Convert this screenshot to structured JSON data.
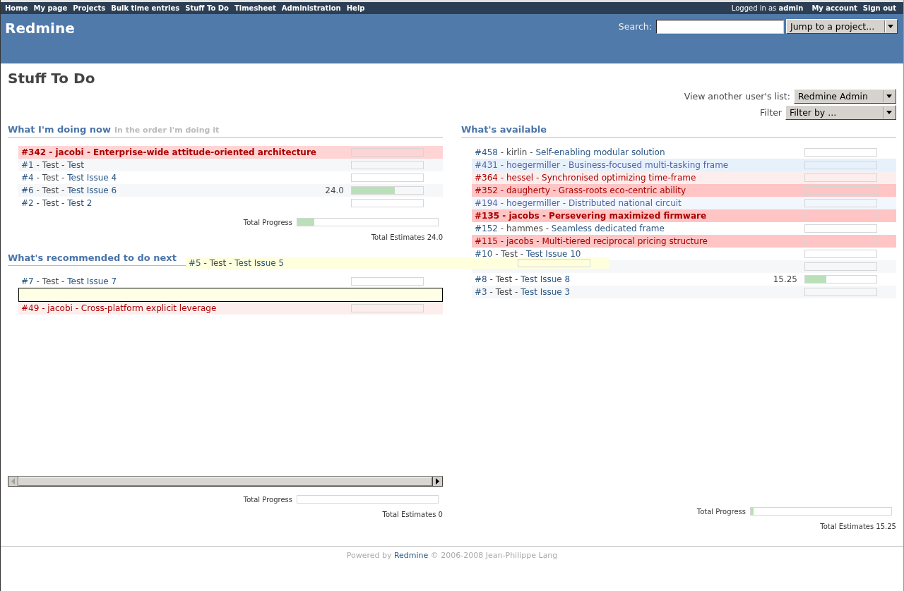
{
  "top_menu": {
    "items": [
      "Home",
      "My page",
      "Projects",
      "Bulk time entries",
      "Stuff To Do",
      "Timesheet",
      "Administration",
      "Help"
    ],
    "account": {
      "logged_in": "Logged in as **admin**",
      "links": [
        "My account",
        "Sign out"
      ]
    }
  },
  "header": {
    "title": "Redmine",
    "search_label": "Search:",
    "project_jump": "Jump to a project..."
  },
  "page_title": "Stuff To Do",
  "user_list": {
    "label": "View another user's list:",
    "value": "Redmine Admin"
  },
  "filter": {
    "label": "Filter",
    "value": "Filter by ..."
  },
  "doing_now": {
    "title": "What I'm doing now",
    "subtitle": "In the order I'm doing it",
    "items": [
      {
        "kind": "immediate",
        "number": "#342",
        "project": "- jacobi -",
        "subject": "Enterprise-wide attitude-oriented architecture",
        "level": 0
      },
      {
        "kind": "normal",
        "number": "#1",
        "project": "- Test -",
        "subject": "Test",
        "level": 0
      },
      {
        "kind": "normal",
        "number": "#4",
        "project": "- Test -",
        "subject": "Test Issue 4",
        "level": 0
      },
      {
        "kind": "normal",
        "number": "#6",
        "project": "- Test -",
        "subject": "Test Issue 6",
        "estimate": "24.0",
        "level": 0.6
      },
      {
        "kind": "normal",
        "number": "#2",
        "project": "- Test -",
        "subject": "Test 2",
        "level": 0
      }
    ],
    "total_progress": {
      "label": "Total Progress",
      "level": 0.12
    },
    "total_estimates": "Total Estimates 24.0"
  },
  "recommended": {
    "title": "What's recommended to do next",
    "items": [
      {
        "kind": "normal",
        "number": "#7",
        "project": "- Test -",
        "subject": "Test Issue 7",
        "level": 0
      },
      {
        "kind": "placeholder"
      },
      {
        "kind": "high",
        "number": "#49",
        "project": "- jacobi -",
        "subject": "Cross-platform explicit leverage",
        "level": 0
      }
    ],
    "total_progress": {
      "label": "Total Progress",
      "level": 0
    },
    "total_estimates": "Total Estimates 0"
  },
  "available": {
    "title": "What's available",
    "items": [
      {
        "kind": "normal",
        "number": "#458",
        "project": "- kirlin -",
        "subject": "Self-enabling modular solution",
        "level": 0
      },
      {
        "kind": "low",
        "number": "#431",
        "project": "- hoegermiller -",
        "subject": "Business-focused multi-tasking frame",
        "level": 0
      },
      {
        "kind": "high",
        "number": "#364",
        "project": "- hessel -",
        "subject": "Synchronised optimizing time-frame",
        "level": 0
      },
      {
        "kind": "urgent",
        "number": "#352",
        "project": "- daugherty -",
        "subject": "Grass-roots eco-centric ability",
        "level": 0
      },
      {
        "kind": "low",
        "number": "#194",
        "project": "- hoegermiller -",
        "subject": "Distributed national circuit",
        "level": 0
      },
      {
        "kind": "immediate",
        "number": "#135",
        "project": "- jacobs -",
        "subject": "Persevering maximized firmware",
        "level": 0
      },
      {
        "kind": "normal",
        "number": "#152",
        "project": "- hammes -",
        "subject": "Seamless dedicated frame",
        "level": 0
      },
      {
        "kind": "urgent",
        "number": "#115",
        "project": "- jacobs -",
        "subject": "Multi-tiered reciprocal pricing structure",
        "level": 0
      },
      {
        "kind": "normal",
        "number": "#10",
        "project": "- Test -",
        "subject": "Test Issue 10",
        "level": 0
      },
      {
        "kind": "normal",
        "level": 0
      },
      {
        "kind": "normal",
        "number": "#8",
        "project": "- Test -",
        "subject": "Test Issue 8",
        "estimate": "15.25",
        "level": 0.3
      },
      {
        "kind": "normal",
        "number": "#3",
        "project": "- Test -",
        "subject": "Test Issue 3",
        "level": 0
      }
    ],
    "total_progress": {
      "label": "Total Progress",
      "level": 0.02
    },
    "total_estimates": "Total Estimates 15.25"
  },
  "dragged_item": {
    "kind": "normal",
    "number": "#5",
    "project": "- Test -",
    "subject": "Test Issue 5",
    "level": 0
  },
  "footer": {
    "prefix": "Powered by",
    "link": "Redmine",
    "suffix": "© 2006-2008 Jean-Philippe Lang"
  }
}
